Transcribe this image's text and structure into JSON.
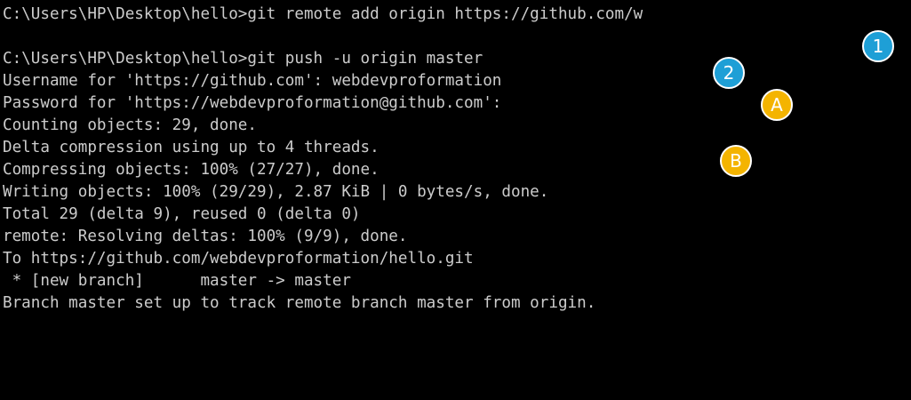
{
  "terminal": {
    "lines": [
      "C:\\Users\\HP\\Desktop\\hello>git remote add origin https://github.com/w",
      "",
      "C:\\Users\\HP\\Desktop\\hello>git push -u origin master",
      "Username for 'https://github.com': webdevproformation",
      "Password for 'https://webdevproformation@github.com':",
      "Counting objects: 29, done.",
      "Delta compression using up to 4 threads.",
      "Compressing objects: 100% (27/27), done.",
      "Writing objects: 100% (29/29), 2.87 KiB | 0 bytes/s, done.",
      "Total 29 (delta 9), reused 0 (delta 0)",
      "remote: Resolving deltas: 100% (9/9), done.",
      "To https://github.com/webdevproformation/hello.git",
      " * [new branch]      master -> master",
      "Branch master set up to track remote branch master from origin."
    ],
    "background": "#000000",
    "text_color": "#cccccc"
  },
  "annotations": [
    {
      "label": "1",
      "color": "#1e9fd6"
    },
    {
      "label": "2",
      "color": "#1e9fd6"
    },
    {
      "label": "A",
      "color": "#f4b400"
    },
    {
      "label": "B",
      "color": "#f4b400"
    }
  ]
}
